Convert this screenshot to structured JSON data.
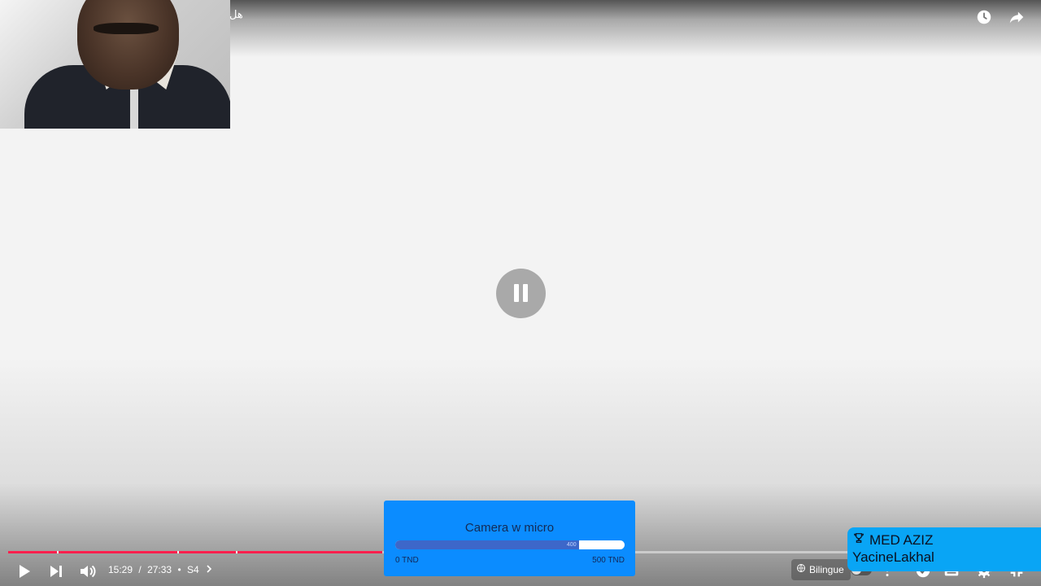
{
  "video": {
    "title": "هل",
    "state": "paused",
    "progress_played_fraction": 0.365,
    "chapter_marks_fraction": [
      0.048,
      0.165,
      0.222
    ]
  },
  "controls": {
    "current_time": "15:29",
    "duration": "27:33",
    "chapter": "S4",
    "time_separator": "/",
    "chapter_separator": "•",
    "bilingue_label": "Bilingue"
  },
  "overlay": {
    "donation_goal": {
      "title": "Camera w micro",
      "current": "400",
      "current_value": 400,
      "max_value": 500,
      "min_label": "0 TND",
      "max_label": "500 TND"
    },
    "top_donor": {
      "line1": "MED AZIZ",
      "line2": "YacineLakhal"
    }
  },
  "colors": {
    "progress": "#ff1f4d",
    "donation_bg": "#0b8cff",
    "goal_fill": "#3d67c9",
    "top_donor_bg": "#09a5f5"
  },
  "icons": [
    "clock-icon",
    "share-icon",
    "pause-icon",
    "play-icon",
    "next-icon",
    "volume-icon",
    "chevron-right-icon",
    "globe-icon",
    "more-icon",
    "check-icon",
    "subtitles-icon",
    "gear-icon",
    "fullscreen-exit-icon",
    "trophy-icon"
  ]
}
